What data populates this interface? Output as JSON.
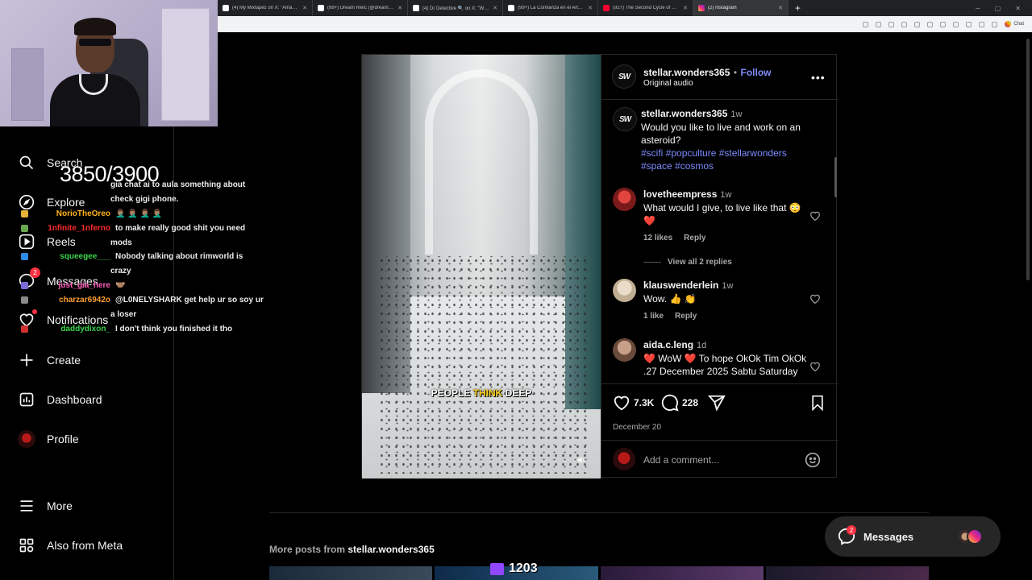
{
  "browser": {
    "tabs": [
      {
        "title": "(4) My Mixtapez on X: \"Amazon w",
        "favicon": "x"
      },
      {
        "title": "(99+) Dream Relic (@dreamrelic)",
        "favicon": "x"
      },
      {
        "title": "(4) Dr Detective 🔍 on X: \"When it",
        "favicon": "x"
      },
      {
        "title": "(99+) La Confianza en el Arte del ",
        "favicon": "x"
      },
      {
        "title": "(927) The Second Cycle of Human",
        "favicon": "yt"
      },
      {
        "title": "(2) Instagram",
        "favicon": "ig",
        "active": true
      }
    ],
    "new_tab": "+",
    "chat_label": "Chat"
  },
  "stream": {
    "viewer_count": "3850/3900",
    "bits_count": "1203"
  },
  "chat": [
    {
      "name": "",
      "message": "gia chat ai to aula something about",
      "color": "#ffffff"
    },
    {
      "name": "",
      "message": "check gigi phone.",
      "color": "#ffffff"
    },
    {
      "name": "NorioTheOreo",
      "message": "🤦🏽‍♂️ 🤦🏽‍♂️ 🤦🏽‍♂️ 🤦🏽‍♂️",
      "color": "#ffb31a"
    },
    {
      "name": "1nfinite_1nferno",
      "message": "to make really good shit you need",
      "color": "#ff2a2a"
    },
    {
      "name": "",
      "message": "mods",
      "color": "#ffffff"
    },
    {
      "name": "squeegee___",
      "message": "Nobody talking about rimworld is",
      "color": "#3cd44b"
    },
    {
      "name": "",
      "message": "crazy",
      "color": "#ffffff"
    },
    {
      "name": "just_gia_here",
      "message": "🤝🏽",
      "color": "#ff5cb8"
    },
    {
      "name": "charzar6942o",
      "message": "@L0NELYSHARK get help ur so soy ur",
      "color": "#ff9f2e"
    },
    {
      "name": "",
      "message": "a loser",
      "color": "#ffffff"
    },
    {
      "name": "daddydixon_",
      "message": "I don't think you finished it tho",
      "color": "#3cd44b"
    }
  ],
  "nav": {
    "items": [
      {
        "label": "Search",
        "icon": "search-icon"
      },
      {
        "label": "Explore",
        "icon": "compass-icon"
      },
      {
        "label": "Reels",
        "icon": "reels-icon"
      },
      {
        "label": "Messages",
        "icon": "messenger-icon",
        "badge": "2"
      },
      {
        "label": "Notifications",
        "icon": "heart-icon"
      },
      {
        "label": "Create",
        "icon": "plus-icon"
      },
      {
        "label": "Dashboard",
        "icon": "dashboard-icon"
      },
      {
        "label": "Profile",
        "icon": "profile-avatar"
      },
      {
        "label": "More",
        "icon": "menu-icon"
      },
      {
        "label": "Also from Meta",
        "icon": "meta-icon"
      }
    ]
  },
  "post": {
    "author": "stellar.wonders365",
    "avatar_text": "SW",
    "follow_label": "Follow",
    "separator": "•",
    "audio": "Original audio",
    "video_caption_pre": "PEOPLE",
    "video_caption_hl": "THINK",
    "video_caption_post": "DEEP",
    "caption": {
      "author": "stellar.wonders365",
      "time": "1w",
      "text": "Would you like to live and work on an asteroid?",
      "tags_line1": "#scifi #popculture #stellarwonders",
      "tags_line2": "#space #cosmos"
    },
    "comments": [
      {
        "author": "lovetheempress",
        "time": "1w",
        "text": "What would I give, to live like that 😳 ❤️",
        "likes": "12 likes",
        "reply": "Reply",
        "view_replies": "View all 2 replies"
      },
      {
        "author": "klauswenderlein",
        "time": "1w",
        "text": "Wow. 👍 👏",
        "likes": "1 like",
        "reply": "Reply"
      },
      {
        "author": "aida.c.leng",
        "time": "1d",
        "text": "❤️ WoW ❤️ To hope OkOk Tim OkOk .27 December 2025 Sabtu Saturday"
      }
    ],
    "likes_count": "7.3K",
    "comments_count": "228",
    "date": "December 20",
    "add_comment_placeholder": "Add a comment..."
  },
  "more_posts": {
    "prefix": "More posts from",
    "author": "stellar.wonders365"
  },
  "messages_pill": {
    "label": "Messages",
    "badge": "2"
  },
  "colors": {
    "accent": "#7c8cff",
    "notification": "#ff3040",
    "twitch": "#9146ff"
  }
}
